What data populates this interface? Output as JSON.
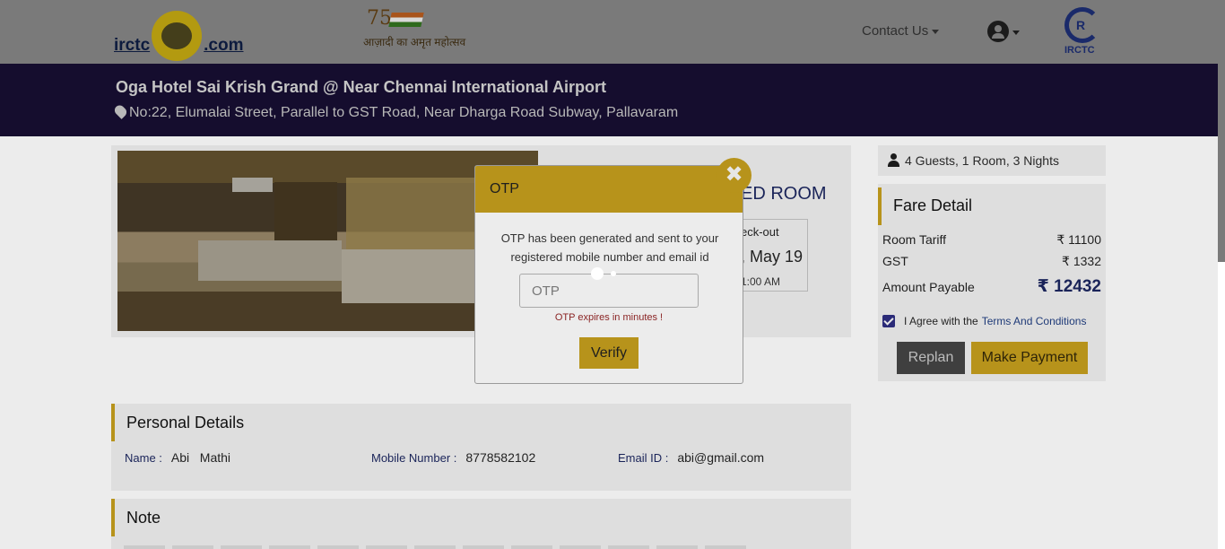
{
  "header": {
    "brand_prefix": "irctc",
    "brand_suffix": ".com",
    "azadi_number": "75",
    "azadi_text": "आज़ादी का अमृत महोत्सव",
    "contact_label": "Contact Us",
    "irctc_logo_label": "IRCTC"
  },
  "hotel": {
    "name": "Oga Hotel Sai Krish Grand @ Near Chennai International Airport",
    "address": "No:22, Elumalai Street, Parallel to GST Road, Near Dharga Road Subway, Pallavaram"
  },
  "room": {
    "title_partial": "ED ROOM",
    "checkout_label": "eck-out",
    "checkout_date": ", May 19",
    "checkout_time": "1:00 AM"
  },
  "booking": {
    "summary": "4 Guests, 1 Room, 3 Nights"
  },
  "fare": {
    "heading": "Fare Detail",
    "room_tariff_label": "Room Tariff",
    "room_tariff_value": "₹ 11100",
    "gst_label": "GST",
    "gst_value": "₹ 1332",
    "payable_label": "Amount Payable",
    "payable_value": "₹ 12432",
    "agree_text": "I Agree with the",
    "terms_link": "Terms And Conditions",
    "agree_checked": true,
    "replan_label": "Replan",
    "pay_label": "Make Payment"
  },
  "personal": {
    "heading": "Personal Details",
    "name_label": "Name :",
    "name_value": "Abi   Mathi",
    "mobile_label": "Mobile Number :",
    "mobile_value": "8778582102",
    "email_label": "Email ID :",
    "email_value": "abi@gmail.com"
  },
  "note": {
    "heading": "Note"
  },
  "otp_modal": {
    "title": "OTP",
    "message": "OTP has been generated and sent to your registered mobile number and email id",
    "input_placeholder": "OTP",
    "input_value": "",
    "expiry_text": "OTP expires in minutes !",
    "verify_label": "Verify",
    "close_symbol": "✖"
  },
  "colors": {
    "accent": "#b7931b",
    "banner": "#150d2e",
    "navy": "#1a2459"
  }
}
